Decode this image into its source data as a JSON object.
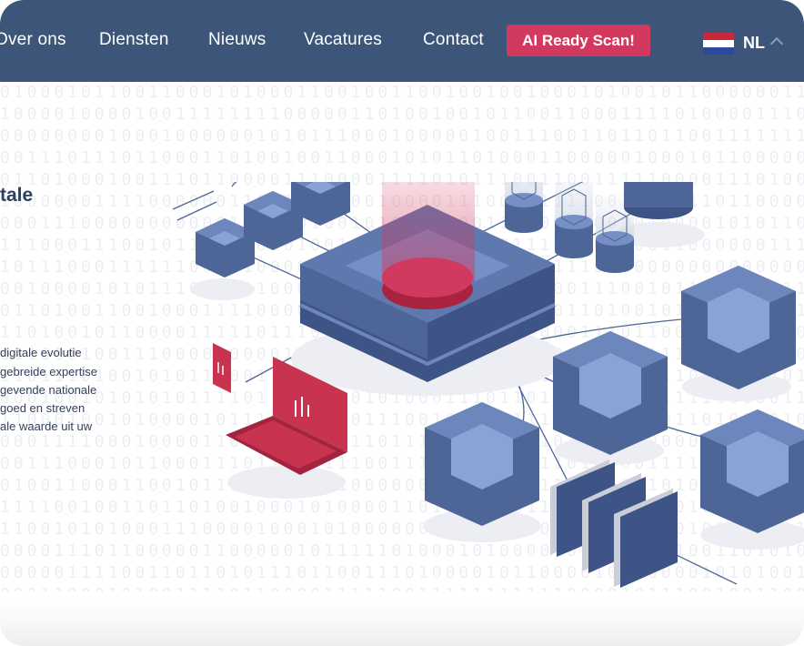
{
  "nav": {
    "items": [
      {
        "id": "over-ons",
        "label": "Over ons"
      },
      {
        "id": "diensten",
        "label": "Diensten"
      },
      {
        "id": "nieuws",
        "label": "Nieuws"
      },
      {
        "id": "vacatures",
        "label": "Vacatures"
      },
      {
        "id": "contact",
        "label": "Contact"
      }
    ],
    "cta_label": "AI Ready Scan!",
    "language": {
      "code": "NL",
      "flag_icon": "netherlands-flag-icon",
      "chevron_icon": "chevron-up-icon"
    }
  },
  "hero": {
    "title_fragment": "tale",
    "lines": [
      "digitale evolutie",
      "gebreide expertise",
      "gevende nationale",
      "goed en streven",
      "ale waarde uit uw"
    ]
  },
  "colors": {
    "navbar": "#3d5579",
    "cta": "#d2395f",
    "cube_dark": "#4e6597",
    "cube_light": "#7690c5",
    "accent_red": "#c8334f"
  }
}
